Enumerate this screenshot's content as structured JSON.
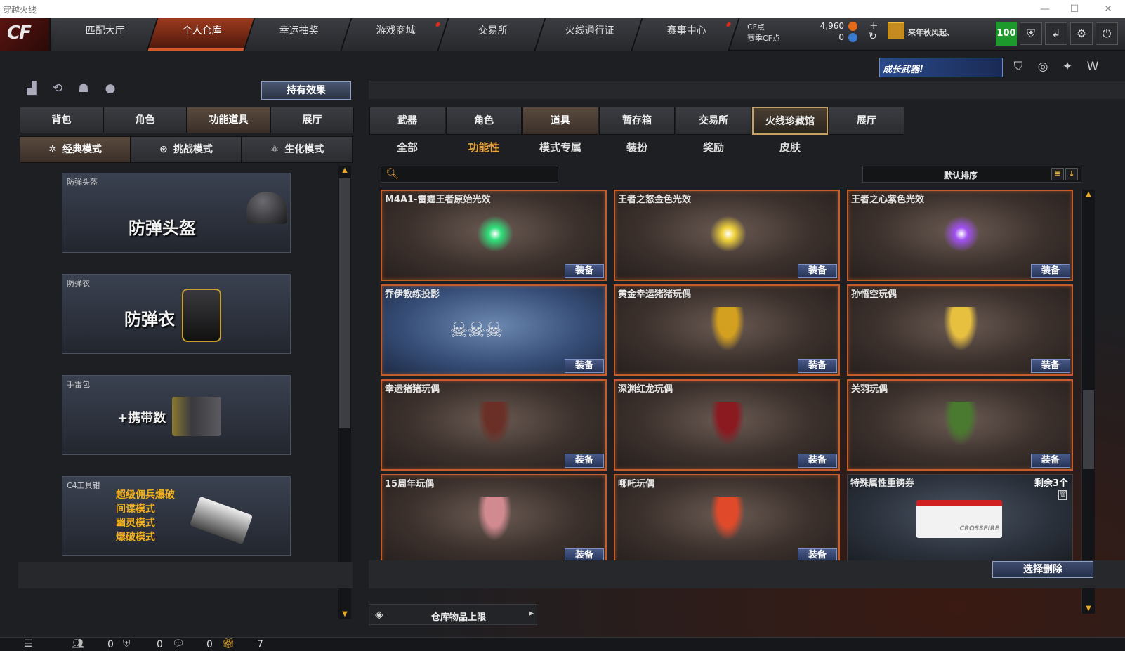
{
  "window": {
    "title": "穿越火线"
  },
  "nav": {
    "tabs": [
      {
        "label": "匹配大厅",
        "dot": false
      },
      {
        "label": "个人仓库",
        "dot": false
      },
      {
        "label": "幸运抽奖",
        "dot": false
      },
      {
        "label": "游戏商城",
        "dot": true
      },
      {
        "label": "交易所",
        "dot": false
      },
      {
        "label": "火线通行证",
        "dot": false
      },
      {
        "label": "赛事中心",
        "dot": true
      }
    ],
    "active_tab": "个人仓库",
    "cf_label": "CF点",
    "season_cf_label": "赛季CF点",
    "cf_value": "4,960",
    "season_cf_value": "0",
    "username": "来年秋风起、",
    "level": "100"
  },
  "banner": {
    "weapon_text": "成长武器!"
  },
  "left": {
    "held_effects": "持有效果",
    "tabs": [
      "背包",
      "角色",
      "功能道具",
      "展厅"
    ],
    "active_tab": "功能道具",
    "modes": [
      "经典模式",
      "挑战模式",
      "生化模式"
    ],
    "active_mode": "经典模式",
    "cards": [
      {
        "label": "防弹头盔",
        "big": "防弹头盔"
      },
      {
        "label": "防弹衣",
        "big": "防弹衣"
      },
      {
        "label": "手雷包",
        "big": "+携带数"
      },
      {
        "label": "C4工具钳",
        "modes": [
          "超级佣兵爆破",
          "间谍模式",
          "幽灵模式",
          "爆破模式"
        ]
      }
    ]
  },
  "right": {
    "tabs": [
      "武器",
      "角色",
      "道具",
      "暂存箱",
      "交易所",
      "火线珍藏馆",
      "展厅"
    ],
    "active_tab": "道具",
    "highlight_tab": "火线珍藏馆",
    "subtabs": [
      "全部",
      "功能性",
      "模式专属",
      "装扮",
      "奖励",
      "皮肤"
    ],
    "active_subtab": "功能性",
    "sort_label": "默认排序",
    "equip_label": "装备",
    "items": [
      {
        "name": "M4A1-雷霆王者原始光效",
        "kind": "orb",
        "color": "#2fe07a"
      },
      {
        "name": "王者之怒金色光效",
        "kind": "orb",
        "color": "#f0d23a"
      },
      {
        "name": "王者之心紫色光效",
        "kind": "orb",
        "color": "#a050f0"
      },
      {
        "name": "乔伊教练投影",
        "kind": "skulls"
      },
      {
        "name": "黄金幸运猪猪玩偶",
        "kind": "fig",
        "color": "#d4a020"
      },
      {
        "name": "孙悟空玩偶",
        "kind": "fig",
        "color": "#e8c040"
      },
      {
        "name": "幸运猪猪玩偶",
        "kind": "fig",
        "color": "#6a3028"
      },
      {
        "name": "深渊红龙玩偶",
        "kind": "fig",
        "color": "#8a1a20"
      },
      {
        "name": "关羽玩偶",
        "kind": "fig",
        "color": "#4a7a30"
      },
      {
        "name": "15周年玩偶",
        "kind": "fig",
        "color": "#d08a90"
      },
      {
        "name": "哪吒玩偶",
        "kind": "fig",
        "color": "#e04a2a"
      },
      {
        "name": "特殊属性重铸券",
        "kind": "ticket",
        "remaining": "剩余3个",
        "brand": "CROSSFIRE"
      }
    ],
    "delete_selected": "选择删除",
    "warehouse_limit": "仓库物品上限"
  },
  "bottom": {
    "counts": [
      "0",
      "0",
      "0",
      "7"
    ]
  }
}
